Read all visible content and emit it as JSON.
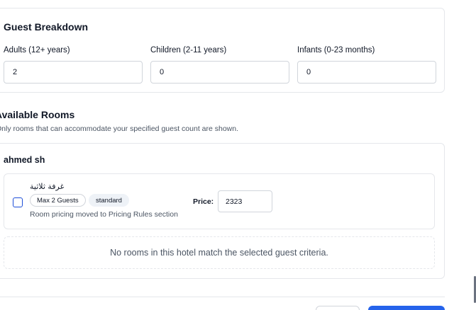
{
  "guest_breakdown": {
    "title": "Guest Breakdown",
    "adults": {
      "label": "Adults (12+ years)",
      "value": "2"
    },
    "children": {
      "label": "Children (2-11 years)",
      "value": "0"
    },
    "infants": {
      "label": "Infants (0-23 months)",
      "value": "0"
    }
  },
  "available_rooms": {
    "title": "Available Rooms",
    "subtitle": "Only rooms that can accommodate your specified guest count are shown.",
    "hotel": {
      "name": "ahmed sh",
      "room": {
        "name": "غرفة ثلاثية",
        "capacity_badge": "Max 2 Guests",
        "type_badge": "standard",
        "note": "Room pricing moved to Pricing Rules section",
        "price_label": "Price:",
        "price_value": "2323",
        "selected": false
      },
      "empty_message": "No rooms in this hotel match the selected guest criteria."
    }
  },
  "footer": {
    "cancel_label": "",
    "submit_label": ""
  },
  "colors": {
    "primary": "#2563eb",
    "border": "#e5e7eb",
    "muted_text": "#4b5563"
  }
}
